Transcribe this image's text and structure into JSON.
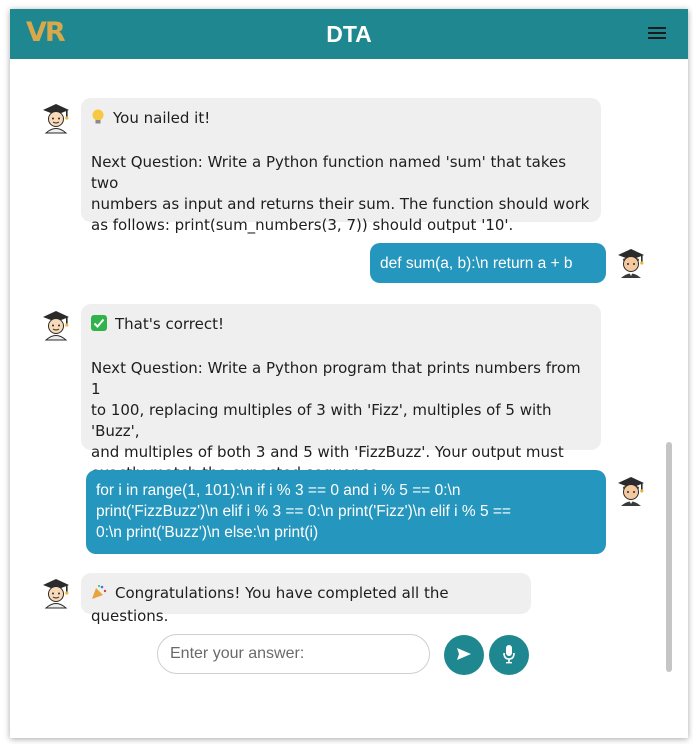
{
  "header": {
    "logo": "VR",
    "title": "DTA",
    "menu_icon": "hamburger-menu-icon"
  },
  "messages": [
    {
      "role": "bot",
      "status_icon": "lightbulb-icon",
      "status": "You nailed it!",
      "lines": [
        "Next Question: Write a Python function named 'sum' that takes two",
        "numbers as input and returns their sum. The function should work",
        "as follows: print(sum_numbers(3, 7)) should output '10'."
      ]
    },
    {
      "role": "user",
      "lines": [
        "def sum(a, b):\\n return a + b"
      ]
    },
    {
      "role": "bot",
      "status_icon": "check-mark-icon",
      "status": "That's correct!",
      "lines": [
        "Next Question: Write a Python program that prints numbers from 1",
        "to 100, replacing multiples of 3 with 'Fizz', multiples of 5 with 'Buzz',",
        "and multiples of both 3 and 5 with 'FizzBuzz'. Your output must",
        "exactly match the expected sequence."
      ]
    },
    {
      "role": "user",
      "lines": [
        "for i in range(1, 101):\\n if i % 3 == 0 and i % 5 == 0:\\n",
        "print('FizzBuzz')\\n elif i % 3 == 0:\\n print('Fizz')\\n elif i % 5 ==",
        "0:\\n print('Buzz')\\n else:\\n print(i)"
      ]
    },
    {
      "role": "bot",
      "status_icon": "party-popper-icon",
      "status": "Congratulations! You have completed all the questions."
    }
  ],
  "input": {
    "placeholder": "Enter your answer:",
    "value": ""
  },
  "buttons": {
    "send_icon": "send-icon",
    "mic_icon": "microphone-icon"
  },
  "colors": {
    "header": "#1f878f",
    "user_bubble": "#2596be",
    "bot_bubble": "#efefef",
    "logo": "#d9a84a"
  }
}
